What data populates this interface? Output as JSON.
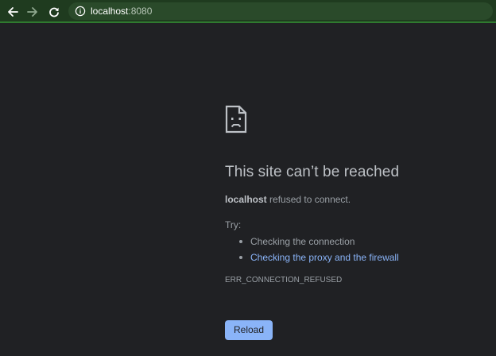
{
  "browser": {
    "url_host": "localhost",
    "url_port": ":8080",
    "icons": {
      "back": "back-arrow-icon",
      "forward": "forward-arrow-icon",
      "reload": "reload-icon",
      "info": "info-icon"
    }
  },
  "error_page": {
    "icon": "sad-page-icon",
    "title": "This site can’t be reached",
    "host": "localhost",
    "message_suffix": " refused to connect.",
    "try_label": "Try:",
    "suggestions": [
      {
        "label": "Checking the connection",
        "is_link": false
      },
      {
        "label": "Checking the proxy and the firewall",
        "is_link": true
      }
    ],
    "error_code": "ERR_CONNECTION_REFUSED",
    "reload_label": "Reload"
  },
  "colors": {
    "toolbar_bg": "#1f3b1f",
    "page_bg": "#202124",
    "title": "#bdc1c6",
    "text": "#9aa0a6",
    "link": "#8ab4f8",
    "button_bg": "#8ab4f8"
  }
}
